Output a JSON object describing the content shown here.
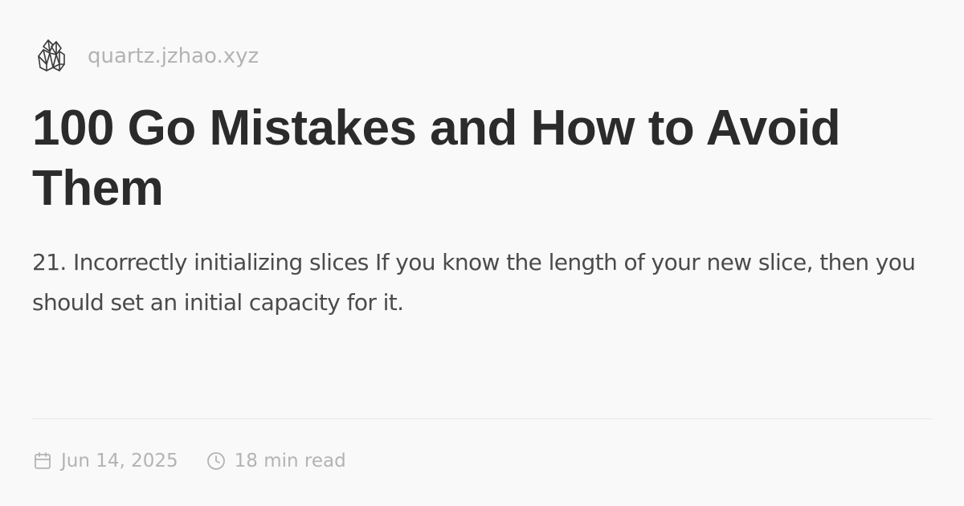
{
  "header": {
    "logo_icon": "crystal-icon",
    "site_name": "quartz.jzhao.xyz"
  },
  "article": {
    "title": "100 Go Mistakes and How to Avoid Them",
    "description": "21. Incorrectly initializing slices If you know the length of your new slice, then you should set an initial capacity for it."
  },
  "meta": {
    "date_icon": "calendar-icon",
    "date": "Jun 14, 2025",
    "reading_time_icon": "clock-icon",
    "reading_time": "18 min read"
  },
  "colors": {
    "background": "#faf9fa",
    "title": "#2b2b2b",
    "body_text": "#4b4b4b",
    "muted": "#b3b3b3",
    "divider": "#e6e6e6"
  }
}
